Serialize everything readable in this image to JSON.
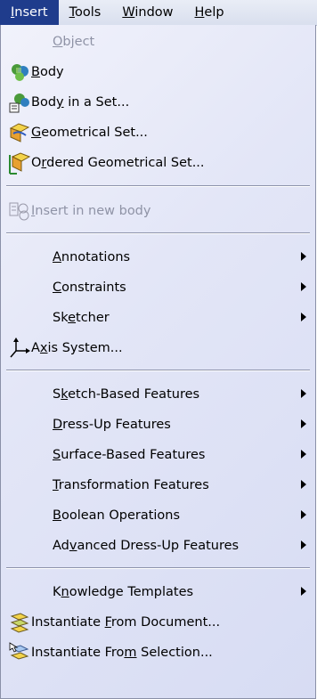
{
  "menubar": {
    "items": [
      {
        "pre": "",
        "key": "I",
        "post": "nsert"
      },
      {
        "pre": "",
        "key": "T",
        "post": "ools"
      },
      {
        "pre": "",
        "key": "W",
        "post": "indow"
      },
      {
        "pre": "",
        "key": "H",
        "post": "elp"
      }
    ]
  },
  "menu": {
    "items": [
      {
        "pre": "",
        "key": "O",
        "post": "bject",
        "disabled": true,
        "icon": "none",
        "submenu": false
      },
      {
        "pre": "",
        "key": "B",
        "post": "ody",
        "disabled": false,
        "icon": "body-icon",
        "submenu": false
      },
      {
        "pre": "Bod",
        "key": "y",
        "post": " in a Set...",
        "disabled": false,
        "icon": "body-in-set-icon",
        "submenu": false
      },
      {
        "pre": "",
        "key": "G",
        "post": "eometrical Set...",
        "disabled": false,
        "icon": "geometrical-set-icon",
        "submenu": false
      },
      {
        "pre": "O",
        "key": "r",
        "post": "dered Geometrical Set...",
        "disabled": false,
        "icon": "ordered-geometrical-set-icon",
        "submenu": false
      },
      {
        "pre": "",
        "key": "I",
        "post": "nsert in new body",
        "disabled": true,
        "icon": "insert-new-body-icon",
        "submenu": false
      },
      {
        "pre": "",
        "key": "A",
        "post": "nnotations",
        "disabled": false,
        "icon": "none",
        "submenu": true
      },
      {
        "pre": "",
        "key": "C",
        "post": "onstraints",
        "disabled": false,
        "icon": "none",
        "submenu": true
      },
      {
        "pre": "Sk",
        "key": "e",
        "post": "tcher",
        "disabled": false,
        "icon": "none",
        "submenu": true
      },
      {
        "pre": "A",
        "key": "x",
        "post": "is System...",
        "disabled": false,
        "icon": "axis-system-icon",
        "submenu": false
      },
      {
        "pre": "S",
        "key": "k",
        "post": "etch-Based Features",
        "disabled": false,
        "icon": "none",
        "submenu": true
      },
      {
        "pre": "",
        "key": "D",
        "post": "ress-Up Features",
        "disabled": false,
        "icon": "none",
        "submenu": true
      },
      {
        "pre": "",
        "key": "S",
        "post": "urface-Based Features",
        "disabled": false,
        "icon": "none",
        "submenu": true
      },
      {
        "pre": "",
        "key": "T",
        "post": "ransformation Features",
        "disabled": false,
        "icon": "none",
        "submenu": true
      },
      {
        "pre": "",
        "key": "B",
        "post": "oolean Operations",
        "disabled": false,
        "icon": "none",
        "submenu": true
      },
      {
        "pre": "Ad",
        "key": "v",
        "post": "anced Dress-Up Features",
        "disabled": false,
        "icon": "none",
        "submenu": true
      },
      {
        "pre": "K",
        "key": "n",
        "post": "owledge Templates",
        "disabled": false,
        "icon": "none",
        "submenu": true
      },
      {
        "pre": "Instantiate ",
        "key": "F",
        "post": "rom Document...",
        "disabled": false,
        "icon": "instantiate-document-icon",
        "submenu": false
      },
      {
        "pre": "Instantiate Fro",
        "key": "m",
        "post": " Selection...",
        "disabled": false,
        "icon": "instantiate-selection-icon",
        "submenu": false
      }
    ]
  }
}
